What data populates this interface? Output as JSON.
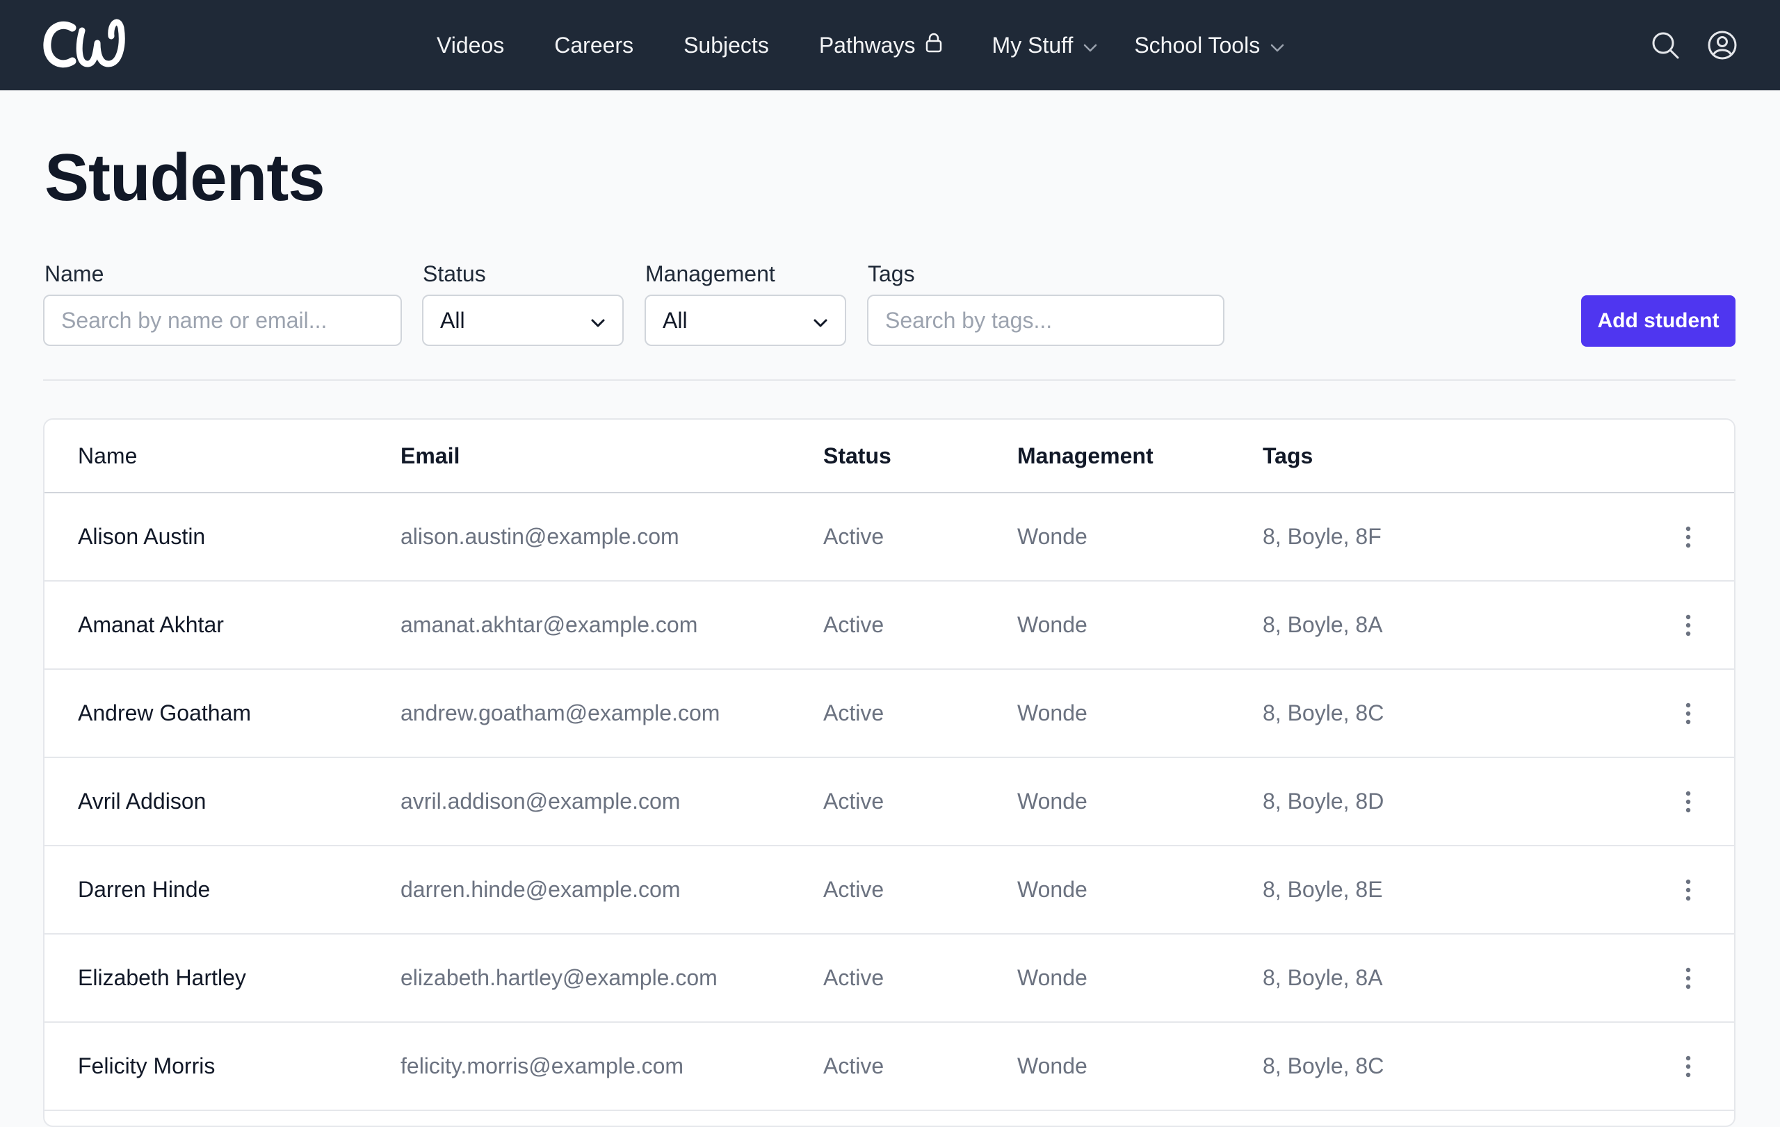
{
  "navbar": {
    "logo_text": "CW",
    "links": [
      {
        "label": "Videos"
      },
      {
        "label": "Careers"
      },
      {
        "label": "Subjects"
      },
      {
        "label": "Pathways",
        "icon": "lock-icon"
      },
      {
        "label": "My Stuff",
        "icon": "chevron-down-icon"
      },
      {
        "label": "School Tools",
        "icon": "chevron-down-icon"
      }
    ],
    "right_icons": [
      "search-icon",
      "user-circle-icon"
    ],
    "colors": {
      "background": "#1f2937",
      "text": "#f3f4f6"
    }
  },
  "page": {
    "title": "Students"
  },
  "filters": {
    "name": {
      "label": "Name",
      "placeholder": "Search by name or email..."
    },
    "status": {
      "label": "Status",
      "value": "All"
    },
    "management": {
      "label": "Management",
      "value": "All"
    },
    "tags": {
      "label": "Tags",
      "placeholder": "Search by tags..."
    }
  },
  "actions": {
    "add_student_label": "Add student",
    "accent_color": "#4f36f0"
  },
  "table": {
    "headers": {
      "name": "Name",
      "email": "Email",
      "status": "Status",
      "management": "Management",
      "tags": "Tags"
    },
    "rows": [
      {
        "name": "Alison Austin",
        "email": "alison.austin@example.com",
        "status": "Active",
        "management": "Wonde",
        "tags": "8, Boyle, 8F"
      },
      {
        "name": "Amanat Akhtar",
        "email": "amanat.akhtar@example.com",
        "status": "Active",
        "management": "Wonde",
        "tags": "8, Boyle, 8A"
      },
      {
        "name": "Andrew Goatham",
        "email": "andrew.goatham@example.com",
        "status": "Active",
        "management": "Wonde",
        "tags": "8, Boyle, 8C"
      },
      {
        "name": "Avril Addison",
        "email": "avril.addison@example.com",
        "status": "Active",
        "management": "Wonde",
        "tags": "8, Boyle, 8D"
      },
      {
        "name": "Darren Hinde",
        "email": "darren.hinde@example.com",
        "status": "Active",
        "management": "Wonde",
        "tags": "8, Boyle, 8E"
      },
      {
        "name": "Elizabeth Hartley",
        "email": "elizabeth.hartley@example.com",
        "status": "Active",
        "management": "Wonde",
        "tags": "8, Boyle, 8A"
      },
      {
        "name": "Felicity Morris",
        "email": "felicity.morris@example.com",
        "status": "Active",
        "management": "Wonde",
        "tags": "8, Boyle, 8C"
      }
    ],
    "row_action_icon": "more-vertical-icon"
  }
}
